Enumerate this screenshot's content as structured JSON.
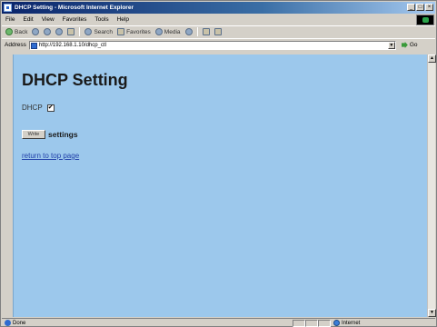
{
  "window": {
    "title": "DHCP Setting - Microsoft Internet Explorer",
    "controls": {
      "minimize": "_",
      "maximize": "□",
      "close": "×"
    }
  },
  "menubar": {
    "items": [
      "File",
      "Edit",
      "View",
      "Favorites",
      "Tools",
      "Help"
    ]
  },
  "toolbar": {
    "back_label": "Back",
    "search_label": "Search",
    "favorites_label": "Favorites",
    "media_label": "Media"
  },
  "addressbar": {
    "label": "Address",
    "url": "http://192.168.1.10/dhcp_ctl",
    "go_label": "Go"
  },
  "page": {
    "heading": "DHCP Setting",
    "dhcp_label": "DHCP",
    "dhcp_checked": true,
    "dhcp_check_glyph": "✔",
    "write_button_label": "Write",
    "settings_text": "settings",
    "top_link_text": "return to top page"
  },
  "statusbar": {
    "status_text": "Done",
    "zone_text": "Internet"
  },
  "colors": {
    "content_background": "#9cc8ec",
    "link": "#1f3fa8",
    "titlebar_start": "#0a246a"
  }
}
